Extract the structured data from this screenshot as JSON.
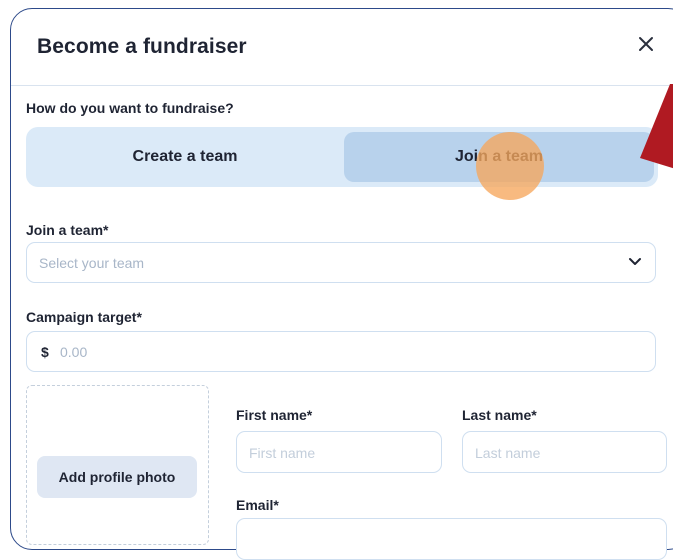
{
  "dialog": {
    "title": "Become a fundraiser",
    "close_icon": "close-icon"
  },
  "fundraise_mode": {
    "question": "How do you want to fundraise?",
    "options": [
      "Create a team",
      "Join a team"
    ],
    "selected": "Join a team"
  },
  "team": {
    "label": "Join a team*",
    "placeholder": "Select your team",
    "icon": "chevron-down-icon"
  },
  "campaign_target": {
    "label": "Campaign target*",
    "currency": "$",
    "placeholder": "0.00"
  },
  "profile_photo": {
    "button_label": "Add profile photo"
  },
  "first_name": {
    "label": "First name*",
    "placeholder": "First name"
  },
  "last_name": {
    "label": "Last name*",
    "placeholder": "Last name"
  },
  "email": {
    "label": "Email*"
  },
  "colors": {
    "border": "#2d4a8a",
    "toggle_bg": "#dbeaf8",
    "toggle_selected": "#b8d2ec",
    "click_highlight": "#f6a65c",
    "pointer_arrow": "#b01a22"
  }
}
